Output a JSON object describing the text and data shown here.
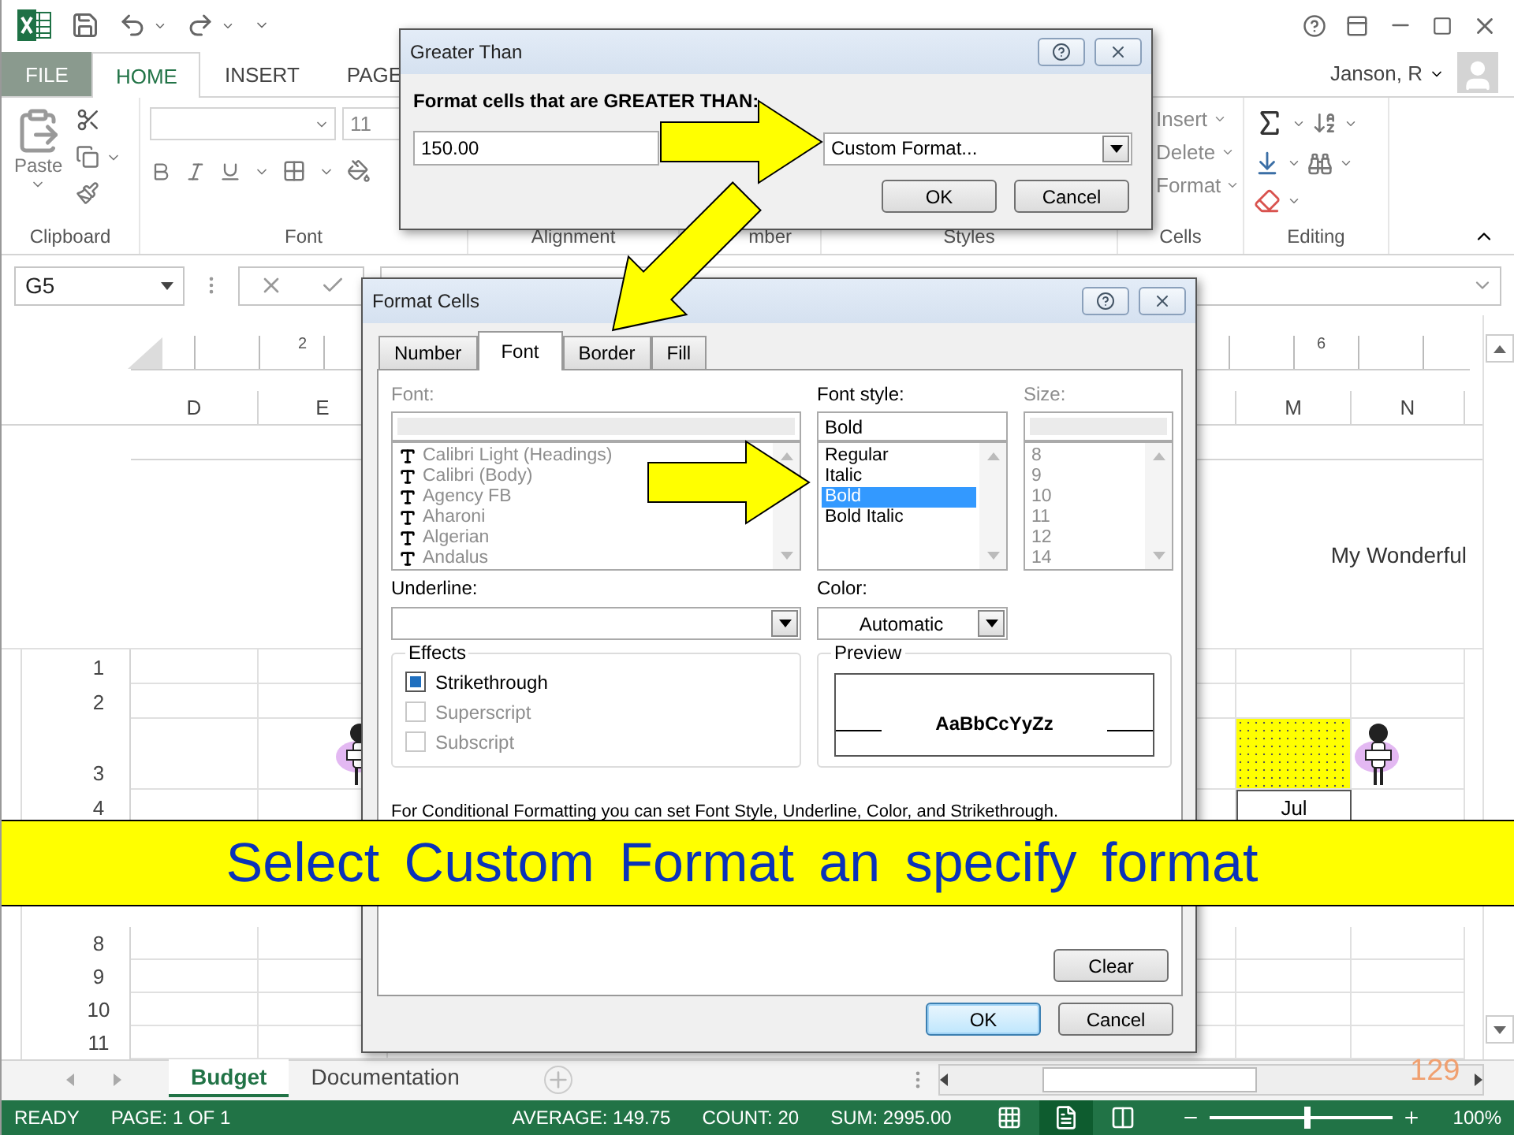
{
  "ribbon_tabs": [
    {
      "label": "FILE",
      "selected": false,
      "kind": "file"
    },
    {
      "label": "HOME",
      "selected": true,
      "kind": "tab"
    },
    {
      "label": "INSERT",
      "selected": false,
      "kind": "tab"
    },
    {
      "label": "PAGE",
      "selected": false,
      "kind": "tab"
    }
  ],
  "account": {
    "name": "Janson, R"
  },
  "ribbon_groups": [
    {
      "label": "Clipboard",
      "kind": "clipboard",
      "paste": "Paste"
    },
    {
      "label": "Font",
      "kind": "font",
      "size": "11"
    },
    {
      "label": "Alignment",
      "kind": "empty"
    },
    {
      "label": "mber",
      "kind": "empty"
    },
    {
      "label": "Styles",
      "kind": "empty"
    },
    {
      "label": "Cells",
      "kind": "cells",
      "buttons": [
        "Insert",
        "Delete",
        "Format"
      ]
    },
    {
      "label": "Editing",
      "kind": "editing"
    }
  ],
  "formula_bar": {
    "name_box": "G5"
  },
  "sheet": {
    "ruler_marks": [
      "2",
      "6"
    ],
    "columns": [
      "D",
      "E",
      "M",
      "N"
    ],
    "header_text": "My Wonderful",
    "row_groups": [
      [
        {
          "label": "1"
        },
        {
          "label": "2"
        },
        {
          "label": "3",
          "figures": true,
          "highlighted": true
        },
        {
          "label": "4",
          "m": "Jul"
        }
      ],
      [
        {
          "label": "8"
        },
        {
          "label": "9"
        },
        {
          "label": "10"
        },
        {
          "label": "11"
        }
      ]
    ]
  },
  "sheet_tabs": [
    {
      "label": "Budget",
      "selected": true
    },
    {
      "label": "Documentation",
      "selected": false
    }
  ],
  "status_bar": {
    "mode": "READY",
    "page": "PAGE: 1 OF 1",
    "average": "AVERAGE: 149.75",
    "count": "COUNT: 20",
    "sum": "SUM: 2995.00",
    "zoom": "100%",
    "zoom_slider": {
      "level": 0.53
    }
  },
  "greater_than_dialog": {
    "title": "Greater Than",
    "prompt": "Format cells that are GREATER THAN:",
    "value": "150.00",
    "format": "Custom Format...",
    "buttons": [
      "OK",
      "Cancel"
    ]
  },
  "format_cells_dialog": {
    "title": "Format Cells",
    "tabs": [
      {
        "label": "Number",
        "selected": false
      },
      {
        "label": "Font",
        "selected": true
      },
      {
        "label": "Border",
        "selected": false
      },
      {
        "label": "Fill",
        "selected": false
      }
    ],
    "font": {
      "label": "Font:",
      "disabled": true,
      "items": [
        "Calibri Light (Headings)",
        "Calibri (Body)",
        "Agency FB",
        "Aharoni",
        "Algerian",
        "Andalus"
      ]
    },
    "font_style": {
      "label": "Font style:",
      "value": "Bold",
      "items": [
        {
          "label": "Regular",
          "selected": false
        },
        {
          "label": "Italic",
          "selected": false
        },
        {
          "label": "Bold",
          "selected": true
        },
        {
          "label": "Bold Italic",
          "selected": false
        }
      ]
    },
    "size": {
      "label": "Size:",
      "disabled": true,
      "items": [
        "8",
        "9",
        "10",
        "11",
        "12",
        "14"
      ]
    },
    "underline": {
      "label": "Underline:"
    },
    "color": {
      "label": "Color:",
      "value": "Automatic"
    },
    "effects": {
      "label": "Effects",
      "items": [
        {
          "label": "Strikethrough",
          "checked": true,
          "disabled": false
        },
        {
          "label": "Superscript",
          "checked": false,
          "disabled": true
        },
        {
          "label": "Subscript",
          "checked": false,
          "disabled": true
        }
      ]
    },
    "preview": {
      "label": "Preview",
      "sample": "AaBbCcYyZz"
    },
    "note": "For Conditional Formatting you can set Font Style, Underline, Color, and Strikethrough.",
    "clear": "Clear",
    "buttons": [
      "OK",
      "Cancel"
    ]
  },
  "banner": {
    "text": "Select Custom Format an specify format"
  },
  "slide_number": "129"
}
